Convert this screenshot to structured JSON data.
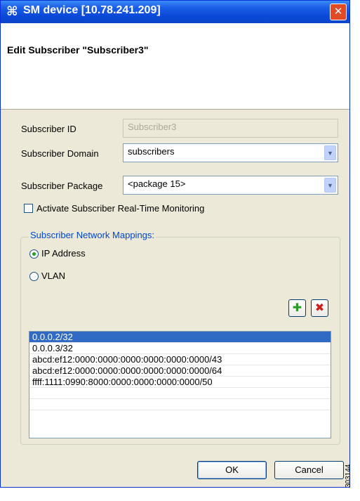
{
  "window": {
    "title": "SM device [10.78.241.209]",
    "close_label": "✕"
  },
  "header": {
    "title": "Edit Subscriber \"Subscriber3\""
  },
  "form": {
    "subscriber_id_label": "Subscriber ID",
    "subscriber_id_value": "Subscriber3",
    "domain_label": "Subscriber Domain",
    "domain_value": "subscribers",
    "package_label": "Subscriber Package",
    "package_value": "<package 15>",
    "monitoring_label": "Activate Subscriber Real-Time Monitoring",
    "monitoring_checked": false
  },
  "mappings": {
    "legend": "Subscriber Network Mappings:",
    "ip_label": "IP Address",
    "vlan_label": "VLAN",
    "selected": "IP Address",
    "items": [
      "0.0.0.2/32",
      "0.0.0.3/32",
      "abcd:ef12:0000:0000:0000:0000:0000:0000/43",
      "abcd:ef12:0000:0000:0000:0000:0000:0000/64",
      "ffff:1111:0990:8000:0000:0000:0000:0000/50"
    ]
  },
  "buttons": {
    "ok": "OK",
    "cancel": "Cancel"
  },
  "figure_id": "303144",
  "colors": {
    "titlebar": "#0a48d8",
    "selection": "#316ac5",
    "legend": "#0046d5"
  }
}
